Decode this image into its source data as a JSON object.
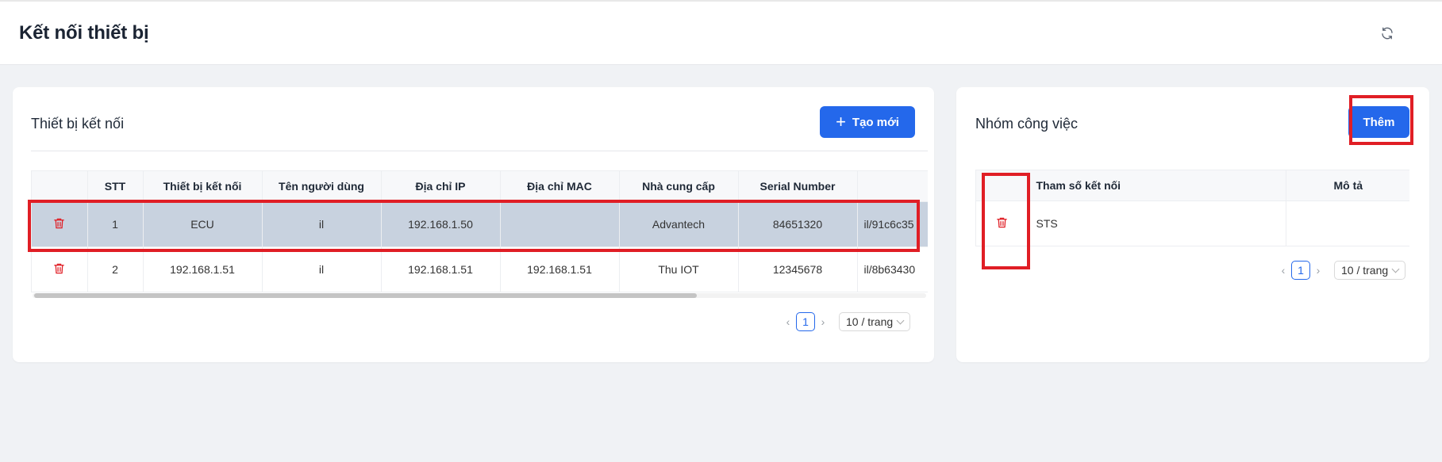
{
  "header": {
    "title": "Kết nối thiết bị",
    "refresh_icon": "refresh-icon"
  },
  "left_card": {
    "title": "Thiết bị kết nối",
    "create_button": "Tạo mới",
    "columns": [
      "",
      "STT",
      "Thiết bị kết nối",
      "Tên người dùng",
      "Địa chỉ IP",
      "Địa chỉ MAC",
      "Nhà cung cấp",
      "Serial Number",
      ""
    ],
    "rows": [
      {
        "stt": "1",
        "device": "ECU",
        "user": "il",
        "ip": "192.168.1.50",
        "mac": "",
        "vendor": "Advantech",
        "serial": "84651320",
        "extra": "il/91c6c35",
        "selected": true
      },
      {
        "stt": "2",
        "device": "192.168.1.51",
        "user": "il",
        "ip": "192.168.1.51",
        "mac": "192.168.1.51",
        "vendor": "Thu IOT",
        "serial": "12345678",
        "extra": "il/8b63430",
        "selected": false
      }
    ],
    "pagination": {
      "prev": "‹",
      "page": "1",
      "next": "›",
      "page_size": "10 / trang"
    }
  },
  "right_card": {
    "title": "Nhóm công việc",
    "add_button": "Thêm",
    "columns": [
      "",
      "Tham số kết nối",
      "Mô tả"
    ],
    "rows": [
      {
        "param": "STS",
        "desc": ""
      }
    ],
    "pagination": {
      "prev": "‹",
      "page": "1",
      "next": "›",
      "page_size": "10 / trang"
    }
  },
  "colors": {
    "primary": "#2468eb",
    "danger": "#e01e25",
    "selected_row": "#c8d2df"
  }
}
